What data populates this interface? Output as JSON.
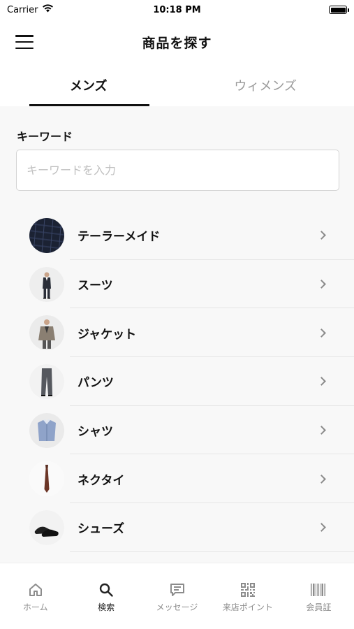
{
  "status_bar": {
    "carrier": "Carrier",
    "time": "10:18 PM"
  },
  "nav": {
    "title": "商品を探す"
  },
  "tabs": [
    {
      "label": "メンズ",
      "active": true
    },
    {
      "label": "ウィメンズ",
      "active": false
    }
  ],
  "search": {
    "label": "キーワード",
    "placeholder": "キーワードを入力",
    "value": ""
  },
  "categories": [
    {
      "label": "テーラーメイド",
      "icon": "fabric-thumbnail"
    },
    {
      "label": "スーツ",
      "icon": "suit-thumbnail"
    },
    {
      "label": "ジャケット",
      "icon": "jacket-thumbnail"
    },
    {
      "label": "パンツ",
      "icon": "pants-thumbnail"
    },
    {
      "label": "シャツ",
      "icon": "shirt-thumbnail"
    },
    {
      "label": "ネクタイ",
      "icon": "necktie-thumbnail"
    },
    {
      "label": "シューズ",
      "icon": "shoes-thumbnail"
    }
  ],
  "tab_bar": [
    {
      "label": "ホーム",
      "icon": "home-icon",
      "active": false
    },
    {
      "label": "検索",
      "icon": "search-icon",
      "active": true
    },
    {
      "label": "メッセージ",
      "icon": "message-icon",
      "active": false
    },
    {
      "label": "来店ポイント",
      "icon": "qr-code-icon",
      "active": false
    },
    {
      "label": "会員証",
      "icon": "barcode-icon",
      "active": false
    }
  ]
}
